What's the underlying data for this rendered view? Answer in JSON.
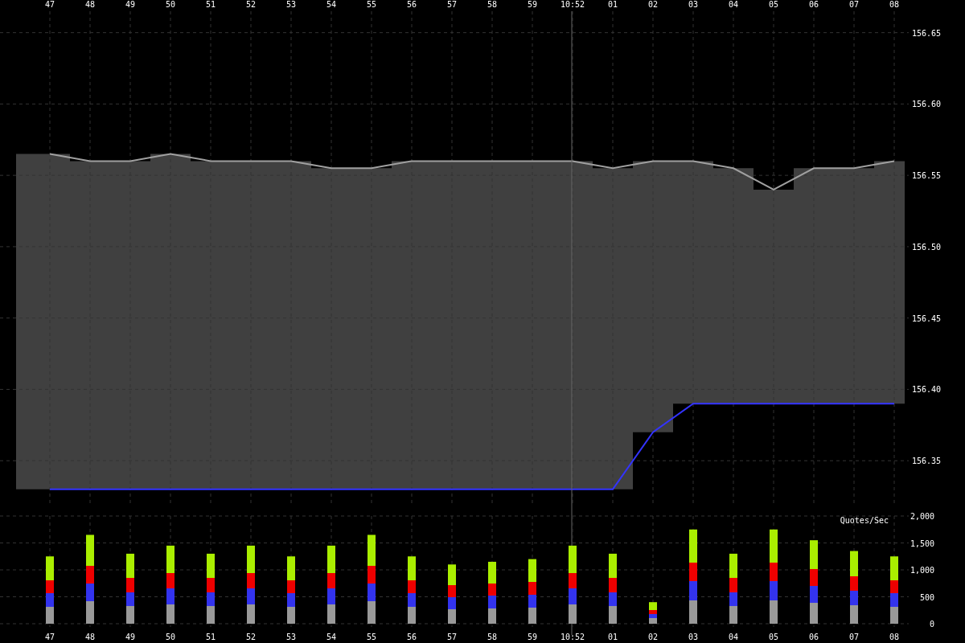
{
  "price_chart": {
    "chart_data": {
      "type": "line",
      "grid": true,
      "categories": [
        "47",
        "48",
        "49",
        "50",
        "51",
        "52",
        "53",
        "54",
        "55",
        "56",
        "57",
        "58",
        "59",
        "10:52",
        "01",
        "02",
        "03",
        "04",
        "05",
        "06",
        "07",
        "08"
      ],
      "series": [
        {
          "color": "#a0a0a0",
          "values": [
            156.565,
            156.56,
            156.56,
            156.565,
            156.56,
            156.56,
            156.56,
            156.555,
            156.555,
            156.56,
            156.56,
            156.56,
            156.56,
            156.56,
            156.555,
            156.56,
            156.56,
            156.555,
            156.54,
            156.555,
            156.555,
            156.56
          ]
        },
        {
          "color": "#3333ff",
          "values": [
            156.33,
            156.33,
            156.33,
            156.33,
            156.33,
            156.33,
            156.33,
            156.33,
            156.33,
            156.33,
            156.33,
            156.33,
            156.33,
            156.33,
            156.33,
            156.37,
            156.39,
            156.39,
            156.39,
            156.39,
            156.39,
            156.39
          ]
        }
      ],
      "ylim": [
        156.318,
        156.665
      ],
      "yticks": [
        {
          "value": 156.65,
          "label": "156.65"
        },
        {
          "value": 156.6,
          "label": "156.60"
        },
        {
          "value": 156.55,
          "label": "156.55"
        },
        {
          "value": 156.5,
          "label": "156.50"
        },
        {
          "value": 156.45,
          "label": "156.45"
        },
        {
          "value": 156.4,
          "label": "156.40"
        },
        {
          "value": 156.35,
          "label": "156.35"
        }
      ]
    }
  },
  "quotes_chart": {
    "title": "Quotes/Sec",
    "chart_data": {
      "type": "bar",
      "grid": true,
      "categories": [
        "47",
        "48",
        "49",
        "50",
        "51",
        "52",
        "53",
        "54",
        "55",
        "56",
        "57",
        "58",
        "59",
        "10:52",
        "01",
        "02",
        "03",
        "04",
        "05",
        "06",
        "07",
        "08"
      ],
      "values": [
        1250,
        1650,
        1300,
        1450,
        1300,
        1450,
        1250,
        1450,
        1650,
        1250,
        1100,
        1150,
        1200,
        1450,
        1300,
        400,
        1750,
        1300,
        1750,
        1550,
        1350,
        1250
      ],
      "ylim": [
        0,
        2000
      ],
      "yticks": [
        {
          "value": 0,
          "label": "0"
        },
        {
          "value": 500,
          "label": "500"
        },
        {
          "value": 1000,
          "label": "1,000"
        },
        {
          "value": 1500,
          "label": "1,500"
        },
        {
          "value": 2000,
          "label": "2,000"
        }
      ]
    }
  }
}
